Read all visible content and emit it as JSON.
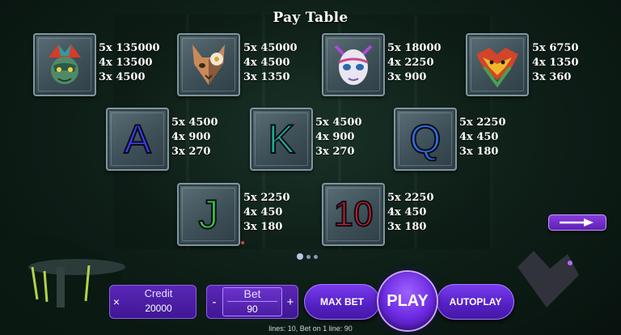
{
  "title": "Pay Table",
  "symbols": {
    "jester": {
      "icon": "jester-mask-icon",
      "pays": [
        "5x 135000",
        "4x 13500",
        "3x 4500"
      ]
    },
    "cat": {
      "icon": "cat-mask-icon",
      "pays": [
        "5x 45000",
        "4x 4500",
        "3x 1350"
      ]
    },
    "white_mask": {
      "icon": "white-mask-icon",
      "pays": [
        "5x 18000",
        "4x 2250",
        "3x 900"
      ]
    },
    "tribal": {
      "icon": "tribal-mask-icon",
      "pays": [
        "5x 6750",
        "4x 1350",
        "3x 360"
      ]
    },
    "a": {
      "letter": "A",
      "color": "#3b3be8",
      "pays": [
        "5x 4500",
        "4x 900",
        "3x 270"
      ]
    },
    "k": {
      "letter": "K",
      "color": "#1fb08a",
      "pays": [
        "5x 4500",
        "4x 900",
        "3x 270"
      ]
    },
    "q": {
      "letter": "Q",
      "color": "#2f6ed8",
      "pays": [
        "5x 2250",
        "4x 450",
        "3x 180"
      ]
    },
    "j": {
      "letter": "J",
      "color": "#35c83a",
      "pays": [
        "5x 2250",
        "4x 450",
        "3x 180"
      ]
    },
    "ten": {
      "letter": "10",
      "color": "#d21f1f",
      "pays": [
        "5x 2250",
        "4x 450",
        "3x 180"
      ]
    }
  },
  "pagination": {
    "pages": 3,
    "active": 1
  },
  "controls": {
    "close": "×",
    "credit_label": "Credit",
    "credit_value": "20000",
    "bet_label": "Bet",
    "bet_value": "90",
    "minus": "-",
    "plus": "+",
    "max_bet": "MAX BET",
    "play": "PLAY",
    "autoplay": "AUTOPLAY"
  },
  "footer": "lines: 10,   Bet on 1 line: 90",
  "colors": {
    "accent": "#6a28e0",
    "next_arrow": "#7b35d8"
  }
}
